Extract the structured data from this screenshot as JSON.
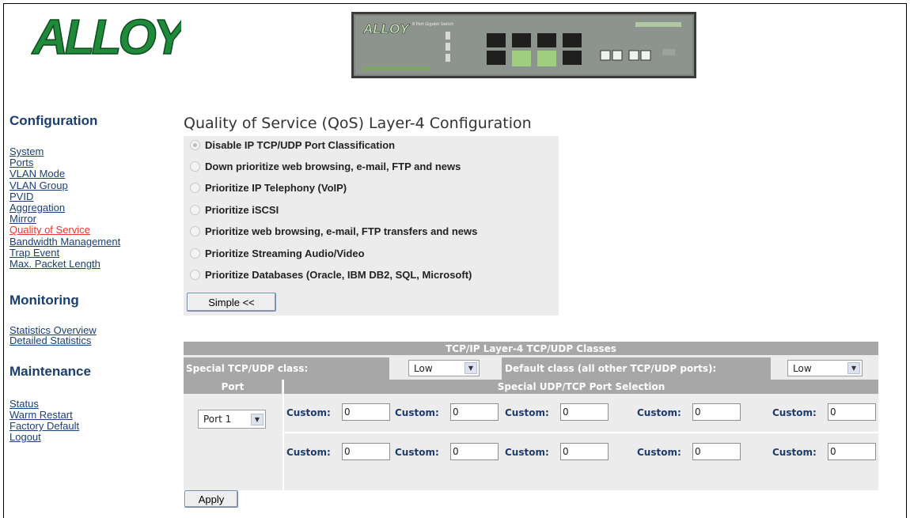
{
  "brand": {
    "logo_text": "ALLOY",
    "logo_color": "#1f8a3c"
  },
  "device_image": {
    "brand_text": "ALLOY",
    "model_text": "8 Port Gigabit Switch"
  },
  "sidebar": {
    "configuration": {
      "heading": "Configuration",
      "items": [
        {
          "label": "System"
        },
        {
          "label": "Ports"
        },
        {
          "label": "VLAN Mode"
        },
        {
          "label": "VLAN Group"
        },
        {
          "label": "PVID"
        },
        {
          "label": "Aggregation"
        },
        {
          "label": "Mirror"
        },
        {
          "label": "Quality of Service",
          "active": true
        },
        {
          "label": "Bandwidth Management"
        },
        {
          "label": "Trap Event"
        },
        {
          "label": "Max. Packet Length"
        }
      ]
    },
    "monitoring": {
      "heading": "Monitoring",
      "items": [
        {
          "label": "Statistics Overview"
        },
        {
          "label": "Detailed Statistics"
        }
      ]
    },
    "maintenance": {
      "heading": "Maintenance",
      "items": [
        {
          "label": "Status"
        },
        {
          "label": "Warm Restart"
        },
        {
          "label": "Factory Default"
        },
        {
          "label": "Logout"
        }
      ]
    },
    "active_color": "#e8362a",
    "link_color": "#1b3f7a"
  },
  "main": {
    "title": "Quality of Service (QoS) Layer-4 Configuration",
    "options": [
      {
        "label": "Disable IP TCP/UDP Port Classification",
        "selected": true
      },
      {
        "label": "Down prioritize web browsing, e-mail, FTP and news",
        "selected": false
      },
      {
        "label": "Prioritize IP Telephony (VoIP)",
        "selected": false
      },
      {
        "label": "Prioritize iSCSI",
        "selected": false
      },
      {
        "label": "Prioritize web browsing, e-mail, FTP transfers and news",
        "selected": false
      },
      {
        "label": "Prioritize Streaming Audio/Video",
        "selected": false
      },
      {
        "label": "Prioritize Databases (Oracle, IBM DB2, SQL, Microsoft)",
        "selected": false
      }
    ],
    "simple_button": "Simple <<",
    "apply_button": "Apply"
  },
  "classes": {
    "header": "TCP/IP Layer-4 TCP/UDP Classes",
    "special_label": "Special TCP/UDP class:",
    "special_value": "Low",
    "default_label": "Default class (all other TCP/UDP ports):",
    "default_value": "Low",
    "port_header": "Port",
    "selection_header": "Special UDP/TCP Port Selection",
    "port_value": "Port 1",
    "custom_label": "Custom:",
    "row1": [
      "0",
      "0",
      "0",
      "0",
      "0"
    ],
    "row2": [
      "0",
      "0",
      "0",
      "0",
      "0"
    ]
  }
}
